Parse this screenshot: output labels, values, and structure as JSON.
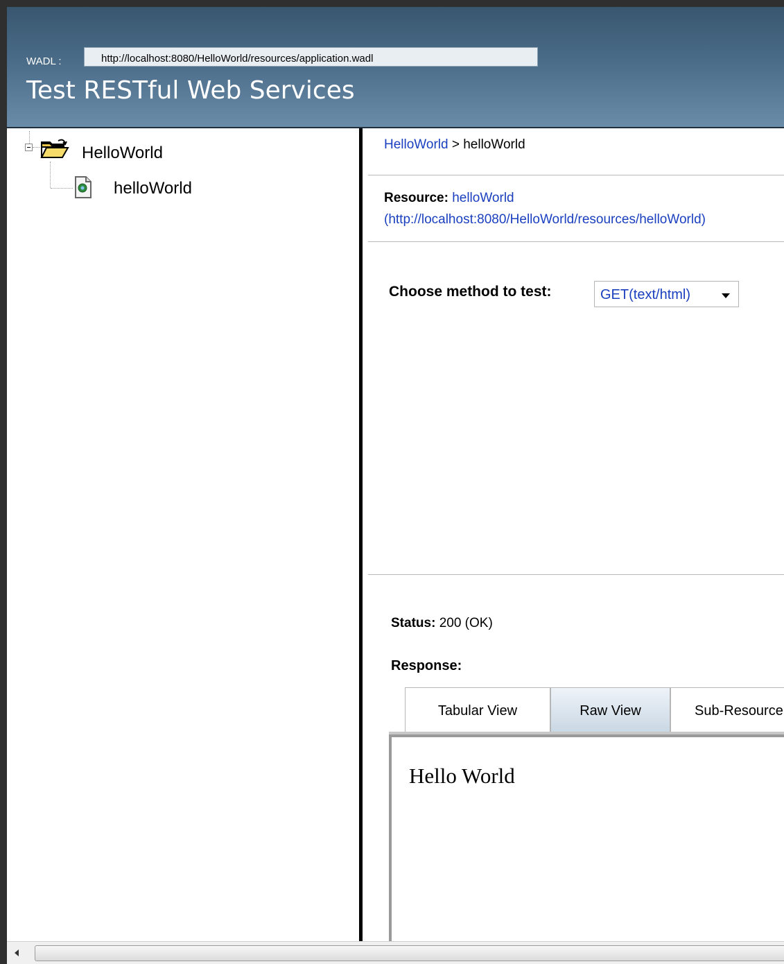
{
  "header": {
    "wadl_label": "WADL :",
    "wadl_url": "http://localhost:8080/HelloWorld/resources/application.wadl",
    "title": "Test RESTful Web Services"
  },
  "tree": {
    "root": {
      "label": "HelloWorld",
      "icon": "folder-open-icon"
    },
    "child": {
      "label": "helloWorld",
      "icon": "resource-file-icon"
    }
  },
  "main": {
    "breadcrumb": {
      "parent": "HelloWorld",
      "separator": " > ",
      "current": "helloWorld"
    },
    "resource": {
      "label": "Resource:",
      "name": "helloWorld",
      "url": "(http://localhost:8080/HelloWorld/resources/helloWorld)"
    },
    "method": {
      "label": "Choose method to test:",
      "selected": "GET(text/html)"
    },
    "status": {
      "label": "Status:",
      "value": "200 (OK)"
    },
    "response": {
      "label": "Response:",
      "tabs": [
        {
          "label": "Tabular View",
          "active": false
        },
        {
          "label": "Raw View",
          "active": true
        },
        {
          "label": "Sub-Resource",
          "active": false
        }
      ],
      "content": "Hello World"
    }
  },
  "colors": {
    "header_dark": "#39566f",
    "header_light": "#6a8ca8",
    "link": "#1a3fbf"
  }
}
